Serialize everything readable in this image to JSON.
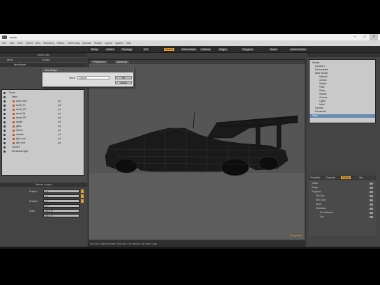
{
  "window": {
    "title": "modo"
  },
  "menu": [
    "File",
    "Edit",
    "View",
    "Select",
    "Item",
    "Geometry",
    "Texture",
    "Vertex Map",
    "Animate",
    "Render",
    "Layout",
    "System",
    "Help"
  ],
  "toolbar": {
    "buttons": [
      "Setup",
      "Model",
      "Topology",
      "UV",
      "Paint",
      "Sculpt",
      "Animate",
      "Render",
      "Games",
      "Select Mode",
      "Vertices",
      "Edges",
      "Polygons",
      "Items",
      "Action Center",
      "Falloff",
      "Snap"
    ],
    "active_index": 7
  },
  "left_panel": {
    "header": "Items Lists",
    "tabs": [
      "Items",
      "Groups"
    ],
    "column_label": "Item Name",
    "items": [
      {
        "label": "Scene",
        "tag": ""
      },
      {
        "label": "Mesh",
        "tag": ""
      },
      {
        "label": "body_main",
        "tag": "pol"
      },
      {
        "label": "wheel_FL",
        "tag": "pol"
      },
      {
        "label": "wheel_FR",
        "tag": "pol"
      },
      {
        "label": "wheel_RL",
        "tag": "pol"
      },
      {
        "label": "wheel_RR",
        "tag": "pol"
      },
      {
        "label": "spoiler",
        "tag": "pol"
      },
      {
        "label": "glass",
        "tag": "pol"
      },
      {
        "label": "interior",
        "tag": "pol"
      },
      {
        "label": "chassis",
        "tag": "pol"
      },
      {
        "label": "light_front",
        "tag": "pol"
      },
      {
        "label": "light_rear",
        "tag": "pol"
      },
      {
        "label": "Camera",
        "tag": ""
      },
      {
        "label": "Directional Light",
        "tag": ""
      }
    ],
    "props_header": "Texture Locator",
    "props": [
      {
        "label": "Position",
        "value": "0 m"
      },
      {
        "label": "",
        "value": "0 m"
      },
      {
        "label": "Rotation",
        "value": "0.0 °"
      },
      {
        "label": "",
        "value": "0.0 °"
      },
      {
        "label": "Scale",
        "value": "100.0 %"
      },
      {
        "label": "",
        "value": "100.0 %"
      }
    ]
  },
  "viewport": {
    "tabs": [
      "Perspective",
      "Advanced"
    ],
    "label": "Perspective"
  },
  "dialog": {
    "title": "New Shape",
    "field_label": "Name",
    "field_value": "Cylinder",
    "ok": "OK",
    "cancel": "Cancel"
  },
  "right_panel": {
    "tree": [
      {
        "label": "Render",
        "indent": 1,
        "selected": false
      },
      {
        "label": "Camera 1",
        "indent": 2,
        "selected": false
      },
      {
        "label": "Environment",
        "indent": 2,
        "selected": false
      },
      {
        "label": "Base Shader",
        "indent": 2,
        "selected": false
      },
      {
        "label": "Material",
        "indent": 3,
        "selected": false
      },
      {
        "label": "Carbon",
        "indent": 3,
        "selected": false
      },
      {
        "label": "Shader",
        "indent": 3,
        "selected": false
      },
      {
        "label": "Paint",
        "indent": 3,
        "selected": false
      },
      {
        "label": "Glass",
        "indent": 3,
        "selected": false
      },
      {
        "label": "Rubber",
        "indent": 3,
        "selected": false
      },
      {
        "label": "Chrome",
        "indent": 3,
        "selected": false
      },
      {
        "label": "Lights",
        "indent": 3,
        "selected": false
      },
      {
        "label": "Metal",
        "indent": 3,
        "selected": false
      },
      {
        "label": "Camera",
        "indent": 2,
        "selected": false
      },
      {
        "label": "Directional",
        "indent": 2,
        "selected": false
      },
      {
        "label": "Mesh",
        "indent": 1,
        "selected": true
      }
    ],
    "tabs": [
      "Properties",
      "Channels",
      "Display",
      "Info"
    ],
    "active_tab": 2,
    "props": [
      "Visible",
      "Shape",
      "Polygons",
      "Fill Color",
      "Dim Color",
      "Draw",
      "Wireframe",
      "Dot Selected",
      "Opt"
    ]
  },
  "statusbar": "Left Click: Select Element, Shift: Add, Ctrl: Remove, Alt: Select Loop"
}
